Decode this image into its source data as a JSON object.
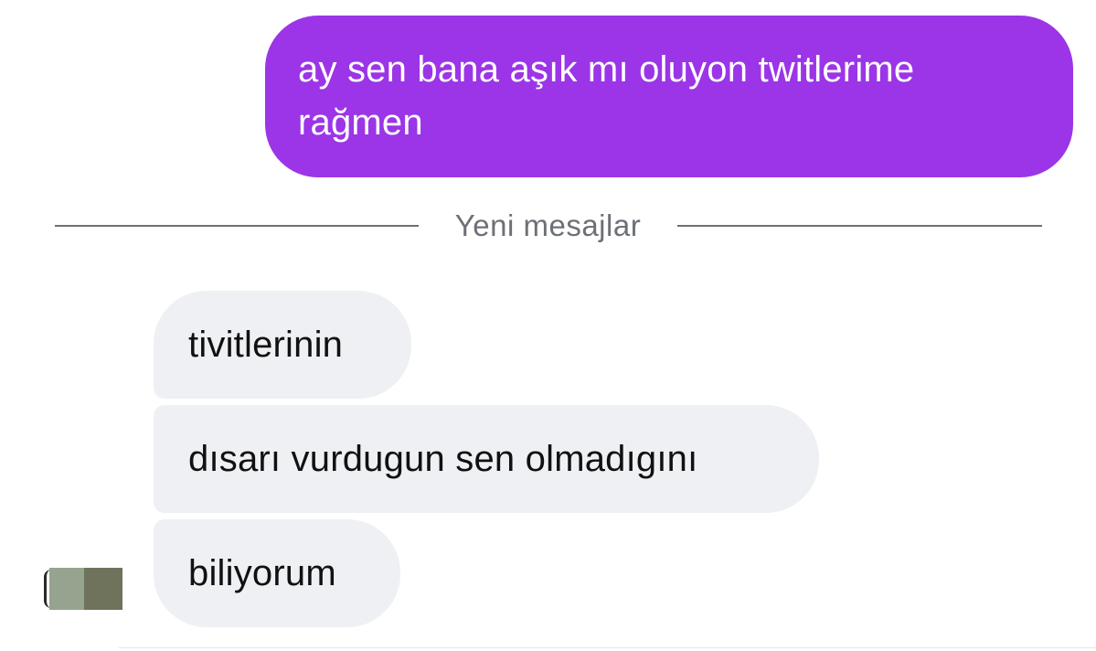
{
  "messages": {
    "sent": [
      {
        "text": "ay sen bana aşık mı oluyon twitlerime\nrağmen"
      }
    ],
    "divider_label": "Yeni mesajlar",
    "received": [
      {
        "text": "tivitlerinin"
      },
      {
        "text": "dısarı vurdugun sen olmadıgını"
      },
      {
        "text": "biliyorum"
      }
    ]
  },
  "colors": {
    "sent_bubble": "#9b35e7",
    "received_bubble": "#eff0f4",
    "divider": "#6e7077",
    "background": "#ffffff"
  },
  "avatar": {
    "icon": "blurred-profile-avatar-icon"
  }
}
